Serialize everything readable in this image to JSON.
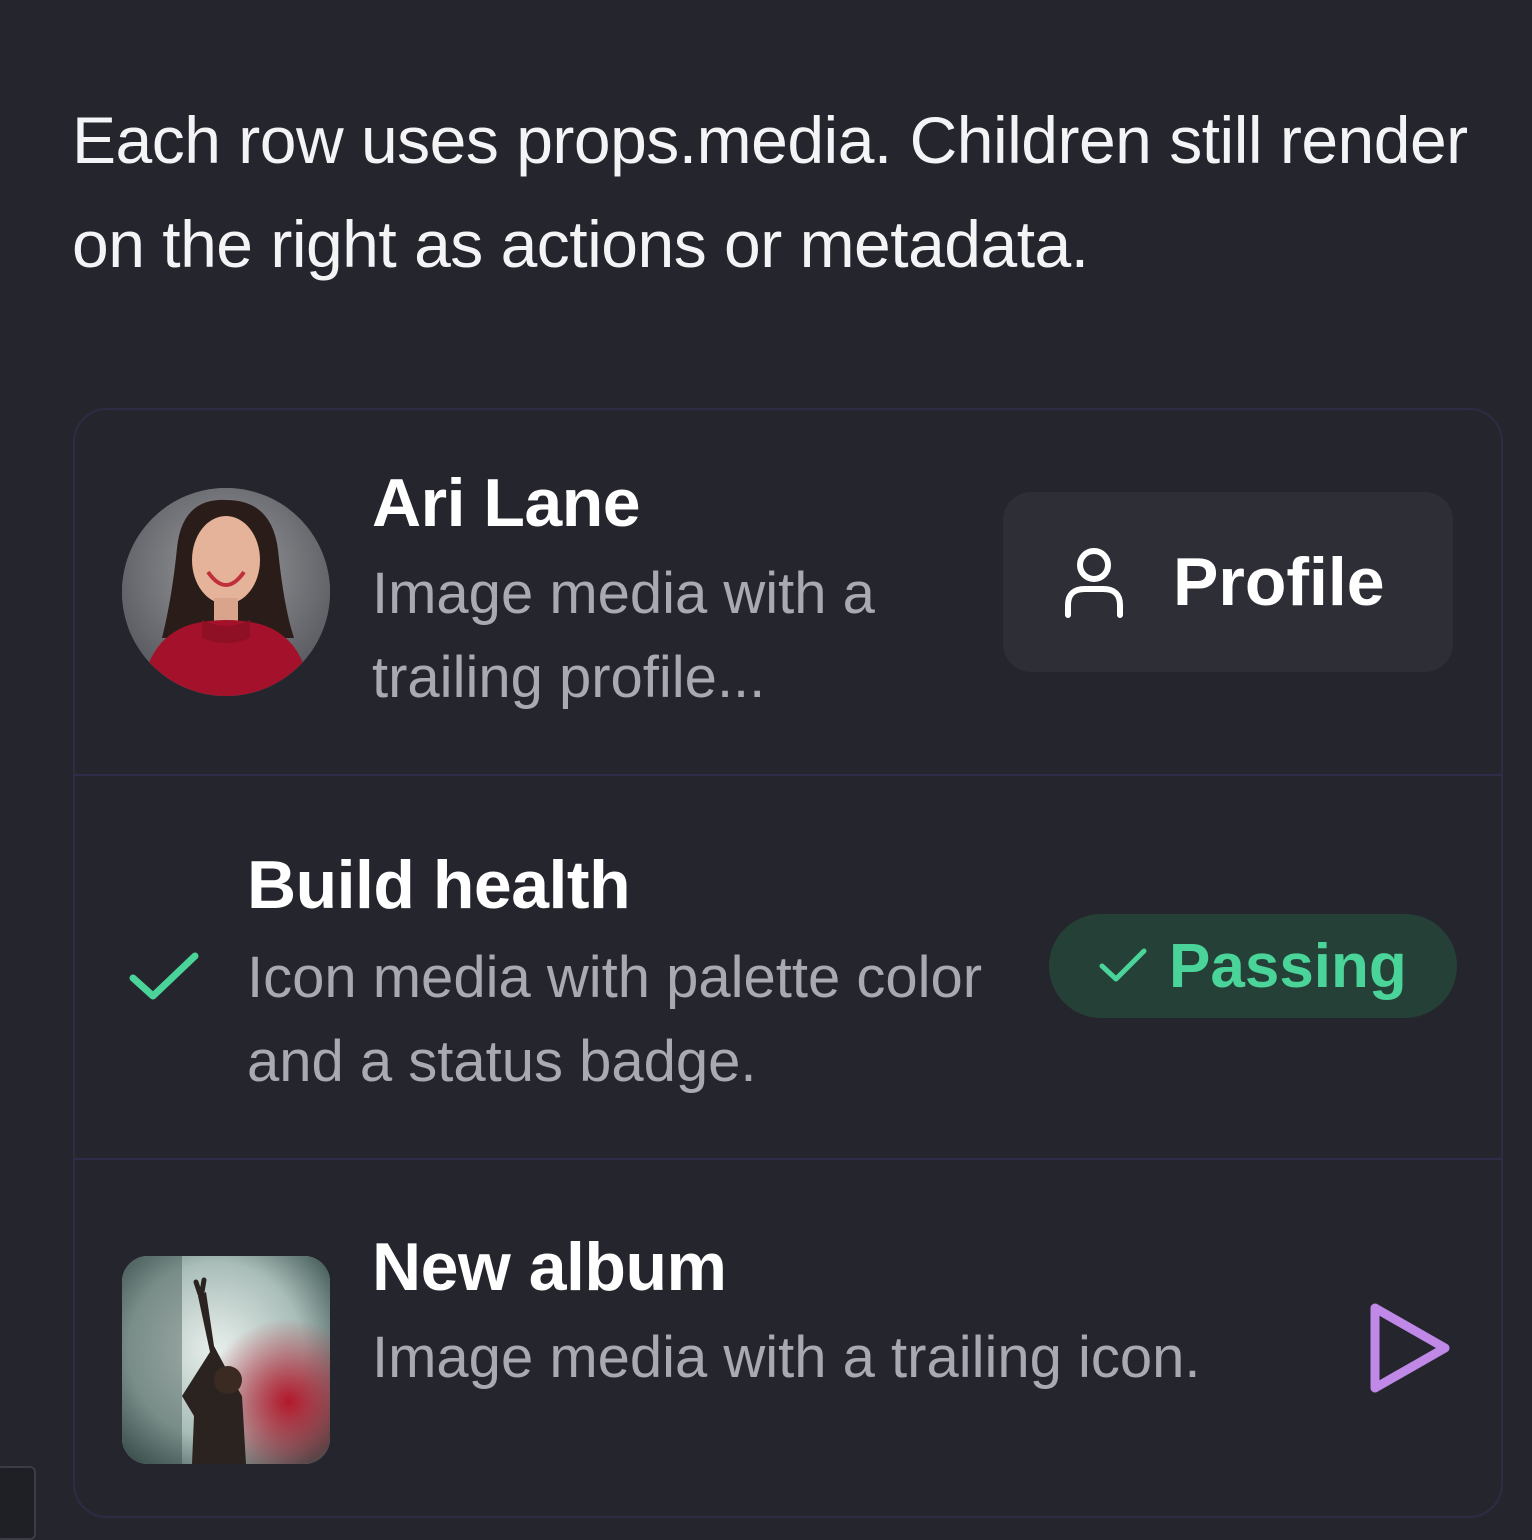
{
  "intro": "Each row uses props.media. Children still render on the right as actions or metadata.",
  "rows": [
    {
      "title": "Ari Lane",
      "description": "Image media with a trailing profile...",
      "media": "avatar-photo",
      "action": {
        "label": "Profile",
        "icon": "user-icon"
      }
    },
    {
      "title": "Build health",
      "description": "Icon media with palette color and a status badge.",
      "media": "check-icon",
      "badge": {
        "label": "Passing",
        "icon": "check-icon",
        "color": "#4ad49a",
        "background": "#254036"
      }
    },
    {
      "title": "New album",
      "description": "Image media with a trailing icon.",
      "media": "album-cover",
      "action": {
        "icon": "play-icon",
        "color": "#c089e8"
      }
    }
  ],
  "colors": {
    "background": "#25262d",
    "border": "#2e2b45",
    "success": "#4ad49a",
    "accent": "#c089e8"
  }
}
